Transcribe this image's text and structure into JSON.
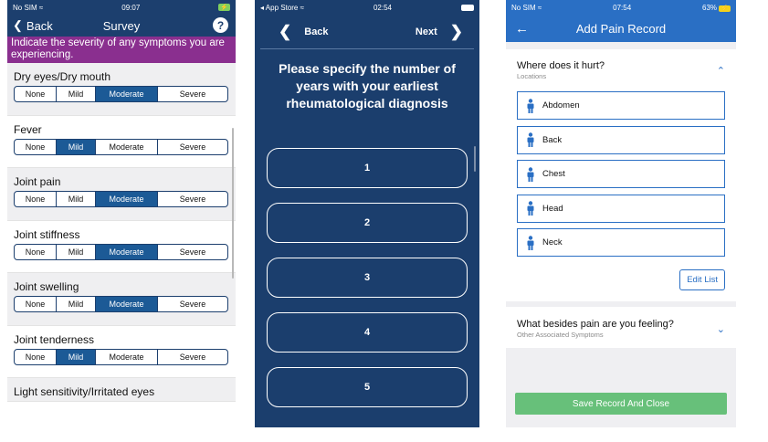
{
  "survey": {
    "status": {
      "carrier": "No SIM",
      "wifi_icon": "wifi-icon",
      "time": "09:07",
      "battery": "⚡"
    },
    "nav": {
      "back_label": "Back",
      "title": "Survey",
      "help_label": "?"
    },
    "banner": "Indicate the severity of any symptoms you are experiencing.",
    "options": [
      "None",
      "Mild",
      "Moderate",
      "Severe"
    ],
    "questions": [
      {
        "label": "Dry eyes/Dry mouth",
        "selected": "Moderate"
      },
      {
        "label": "Fever",
        "selected": "Mild"
      },
      {
        "label": "Joint pain",
        "selected": "Moderate"
      },
      {
        "label": "Joint stiffness",
        "selected": "Moderate"
      },
      {
        "label": "Joint swelling",
        "selected": "Moderate"
      },
      {
        "label": "Joint tenderness",
        "selected": "Mild"
      },
      {
        "label": "Light sensitivity/Irritated eyes",
        "selected": null
      }
    ]
  },
  "question_screen": {
    "status": {
      "carrier": "◂ App Store",
      "wifi_icon": "wifi-icon",
      "time": "02:54"
    },
    "nav": {
      "back_label": "Back",
      "next_label": "Next"
    },
    "question": "Please specify the number of years with your earliest rheumatological diagnosis",
    "options": [
      "1",
      "2",
      "3",
      "4",
      "5"
    ]
  },
  "pain_record": {
    "status": {
      "carrier": "No SIM",
      "wifi_icon": "wifi-icon",
      "time": "07:54",
      "battery_pct": "63%",
      "battery_icon": "⚡"
    },
    "nav": {
      "back_icon": "←",
      "title": "Add Pain Record"
    },
    "locations_section": {
      "title": "Where does it hurt?",
      "subtitle": "Locations"
    },
    "locations": [
      "Abdomen",
      "Back",
      "Chest",
      "Head",
      "Neck"
    ],
    "edit_list_label": "Edit List",
    "symptoms_section": {
      "title": "What besides pain are you feeling?",
      "subtitle": "Other Associated Symptoms"
    },
    "save_label": "Save Record And Close",
    "colors": {
      "accent": "#2a6fc4",
      "save": "#67c07a"
    }
  }
}
